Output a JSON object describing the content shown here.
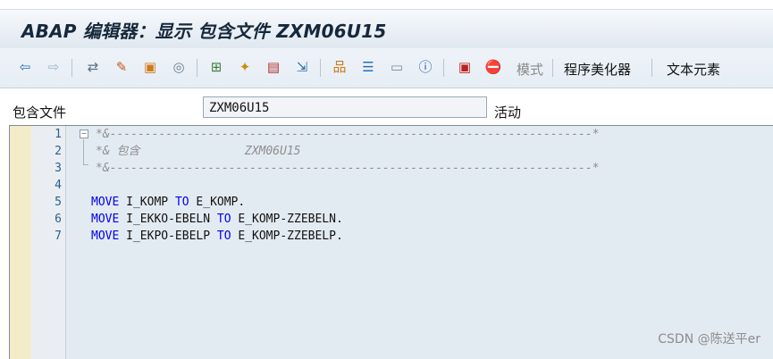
{
  "window": {
    "title": "ABAP 编辑器：显示 包含文件 ZXM06U15"
  },
  "toolbar": {
    "icons": [
      "back-icon",
      "forward-icon",
      "other-object-icon",
      "display-change-icon",
      "activate-icon",
      "spiral-icon",
      "where-used-icon",
      "magic-wand-icon",
      "display-object-list-icon",
      "navigate-icon",
      "hierarchy-icon",
      "list-icon",
      "window-icon",
      "info-icon",
      "test-icon",
      "stop-breakpoint-icon"
    ],
    "mode_label": "模式",
    "pretty_printer_label": "程序美化器",
    "text_elements_label": "文本元素"
  },
  "include_field": {
    "label": "包含文件",
    "value": "ZXM06U15",
    "status": "活动"
  },
  "editor": {
    "line_numbers": [
      "1",
      "2",
      "3",
      "4",
      "5",
      "6",
      "7"
    ],
    "lines": [
      {
        "parts": [
          {
            "t": "*&---------------------------------------------------------------------*",
            "c": "comment"
          }
        ]
      },
      {
        "parts": [
          {
            "t": "*& 包含               ZXM06U15",
            "c": "comment"
          }
        ]
      },
      {
        "parts": [
          {
            "t": "*&---------------------------------------------------------------------*",
            "c": "comment"
          }
        ]
      },
      {
        "parts": [
          {
            "t": "",
            "c": "tx"
          }
        ]
      },
      {
        "parts": [
          {
            "t": "MOVE",
            "c": "kw"
          },
          {
            "t": " I_KOMP ",
            "c": "tx"
          },
          {
            "t": "TO",
            "c": "kw"
          },
          {
            "t": " E_KOMP.",
            "c": "tx"
          }
        ]
      },
      {
        "parts": [
          {
            "t": "MOVE",
            "c": "kw"
          },
          {
            "t": " I_EKKO-EBELN ",
            "c": "tx"
          },
          {
            "t": "TO",
            "c": "kw"
          },
          {
            "t": " E_KOMP-ZZEBELN.",
            "c": "tx"
          }
        ]
      },
      {
        "parts": [
          {
            "t": "MOVE",
            "c": "kw"
          },
          {
            "t": " I_EKPO-EBELP ",
            "c": "tx"
          },
          {
            "t": "TO",
            "c": "kw"
          },
          {
            "t": " E_KOMP-ZZEBELP.",
            "c": "tx"
          }
        ]
      }
    ]
  },
  "watermark": "CSDN @陈送平er"
}
